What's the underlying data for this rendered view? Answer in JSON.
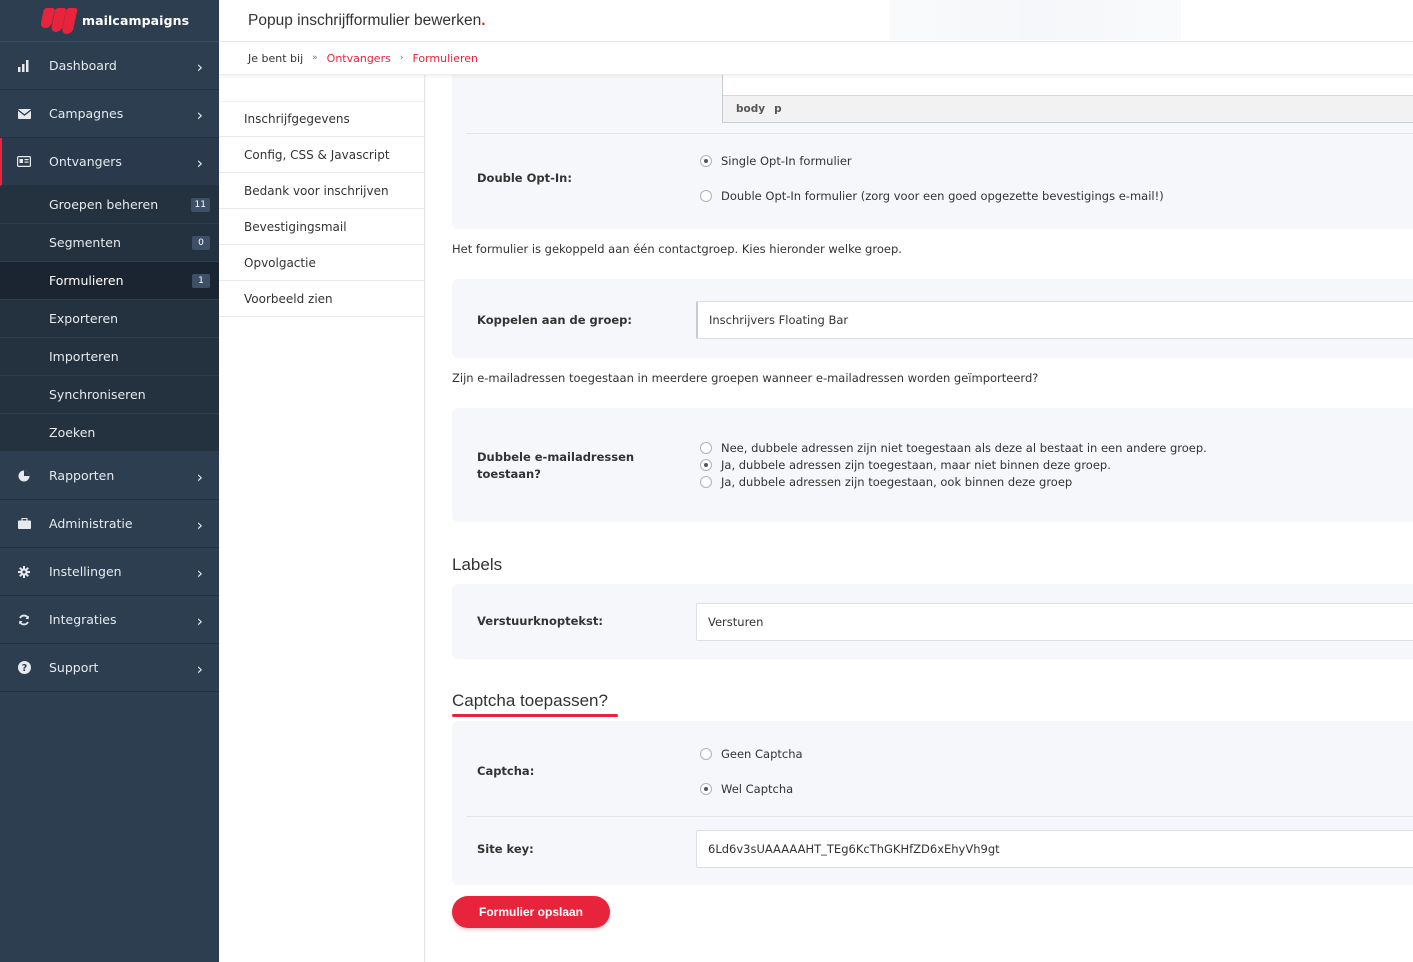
{
  "brand": {
    "name": "mailcampaigns",
    "accent": "#e8243d",
    "sidebar_bg": "#2c3e50"
  },
  "header": {
    "title": "Popup inschrijfformulier bewerken",
    "title_dot": "."
  },
  "breadcrumb": {
    "lead": "Je bent bij",
    "sep1": "»",
    "link1": "Ontvangers",
    "sep2": "›",
    "link2": "Formulieren"
  },
  "sidebar": {
    "items": [
      {
        "label": "Dashboard",
        "icon": "bar-chart-icon"
      },
      {
        "label": "Campagnes",
        "icon": "envelope-icon"
      },
      {
        "label": "Ontvangers",
        "icon": "address-card-icon"
      },
      {
        "label": "Rapporten",
        "icon": "pie-chart-icon"
      },
      {
        "label": "Administratie",
        "icon": "briefcase-icon"
      },
      {
        "label": "Instellingen",
        "icon": "gear-icon"
      },
      {
        "label": "Integraties",
        "icon": "sync-icon"
      },
      {
        "label": "Support",
        "icon": "question-icon"
      }
    ],
    "chevron": "›",
    "subitems": [
      {
        "label": "Groepen beheren",
        "badge": "11"
      },
      {
        "label": "Segmenten",
        "badge": "0"
      },
      {
        "label": "Formulieren",
        "badge": "1"
      },
      {
        "label": "Exporteren"
      },
      {
        "label": "Importeren"
      },
      {
        "label": "Synchroniseren"
      },
      {
        "label": "Zoeken"
      }
    ]
  },
  "subnav": [
    "Inschrijfgegevens",
    "Config, CSS & Javascript",
    "Bedank voor inschrijven",
    "Bevestigingsmail",
    "Opvolgactie",
    "Voorbeeld zien"
  ],
  "editor": {
    "path": [
      "body",
      "p"
    ]
  },
  "optin": {
    "label": "Double Opt-In:",
    "options": [
      "Single Opt-In formulier",
      "Double Opt-In formulier (zorg voor een goed opgezette bevestigings e-mail!)"
    ],
    "selected": 0
  },
  "group_info": "Het formulier is gekoppeld aan één contactgroep. Kies hieronder welke groep.",
  "group": {
    "label": "Koppelen aan de groep:",
    "value": "Inschrijvers Floating Bar"
  },
  "duplicates_info": "Zijn e-mailadressen toegestaan in meerdere groepen wanneer e-mailadressen worden geïmporteerd?",
  "duplicates": {
    "label_line1": "Dubbele e-mailadressen",
    "label_line2": "toestaan?",
    "options": [
      "Nee, dubbele adressen zijn niet toegestaan als deze al bestaat in een andere groep.",
      "Ja, dubbele adressen zijn toegestaan, maar niet binnen deze groep.",
      "Ja, dubbele adressen zijn toegestaan, ook binnen deze groep"
    ],
    "selected": 1
  },
  "labels_section": {
    "title": "Labels",
    "button_label": "Verstuurknoptekst:",
    "button_value": "Versturen"
  },
  "captcha": {
    "title": "Captcha toepassen?",
    "label": "Captcha:",
    "options": [
      "Geen Captcha",
      "Wel Captcha"
    ],
    "selected": 1,
    "sitekey_label": "Site key:",
    "sitekey_value": "6Ld6v3sUAAAAAHT_TEg6KcThGKHfZD6xEhyVh9gt"
  },
  "save_button": "Formulier opslaan"
}
